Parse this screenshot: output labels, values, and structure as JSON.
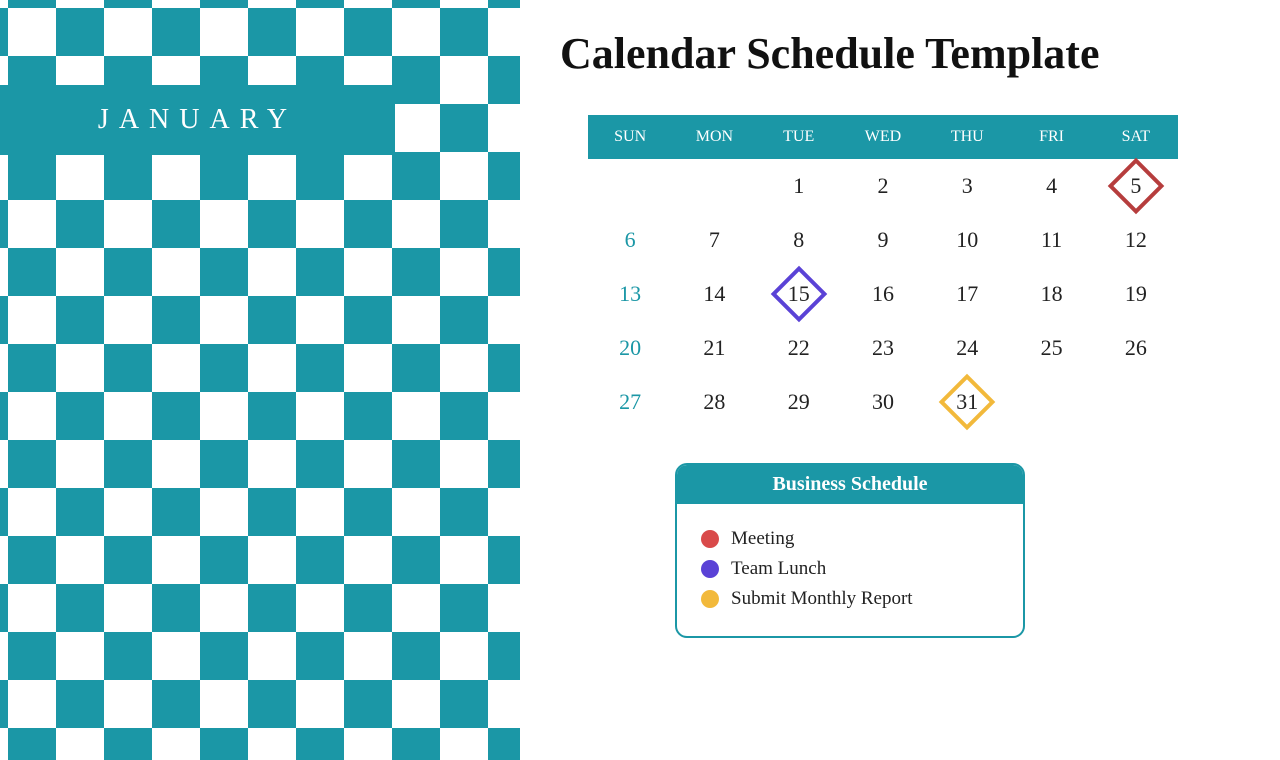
{
  "month_name": "JANUARY",
  "title": "Calendar Schedule Template",
  "day_headers": [
    "SUN",
    "MON",
    "TUE",
    "WED",
    "THU",
    "FRI",
    "SAT"
  ],
  "weeks": [
    [
      "",
      "",
      "1",
      "2",
      "3",
      "4",
      "5"
    ],
    [
      "6",
      "7",
      "8",
      "9",
      "10",
      "11",
      "12"
    ],
    [
      "13",
      "14",
      "15",
      "16",
      "17",
      "18",
      "19"
    ],
    [
      "20",
      "21",
      "22",
      "23",
      "24",
      "25",
      "26"
    ],
    [
      "27",
      "28",
      "29",
      "30",
      "31",
      "",
      ""
    ]
  ],
  "markers": {
    "5": "red",
    "15": "purple",
    "31": "orange"
  },
  "legend": {
    "title": "Business Schedule",
    "items": [
      {
        "color": "red",
        "label": "Meeting"
      },
      {
        "color": "purple",
        "label": "Team Lunch"
      },
      {
        "color": "orange",
        "label": "Submit Monthly Report"
      }
    ]
  },
  "colors": {
    "teal": "#1b97a6",
    "red": "#d94a4a",
    "purple": "#5a42d6",
    "orange": "#f2b93b"
  }
}
